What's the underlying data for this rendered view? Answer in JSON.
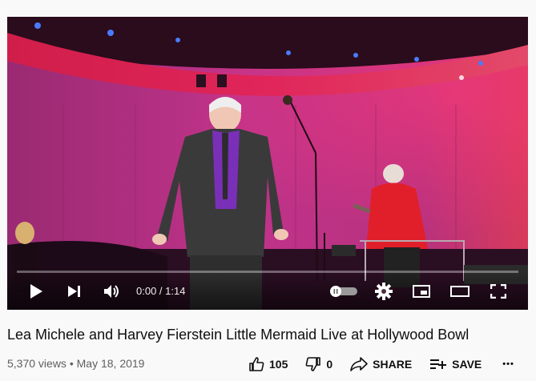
{
  "video": {
    "title": "Lea Michele and Harvey Fierstein Little Mermaid Live at Hollywood Bowl",
    "views": "5,370 views",
    "separator": "•",
    "date": "May 18, 2019",
    "progress": 0.0
  },
  "player": {
    "current_time": "0:00",
    "duration": "1:14",
    "time_separator": " / "
  },
  "actions": {
    "like_count": "105",
    "dislike_count": "0",
    "share_label": "SHARE",
    "save_label": "SAVE",
    "more_label": "•••"
  },
  "icons": {
    "play": "play-icon",
    "next": "next-icon",
    "volume": "volume-icon",
    "autoplay": "autoplay-toggle",
    "settings": "gear-icon",
    "miniplayer": "miniplayer-icon",
    "theater": "theater-icon",
    "fullscreen": "fullscreen-icon",
    "like": "thumbs-up-icon",
    "dislike": "thumbs-down-icon",
    "share": "share-icon",
    "save": "playlist-add-icon",
    "more": "more-icon"
  },
  "colors": {
    "progress": "#ff0000",
    "stage_magenta": "#c22a86",
    "stage_red": "#e4204a"
  }
}
